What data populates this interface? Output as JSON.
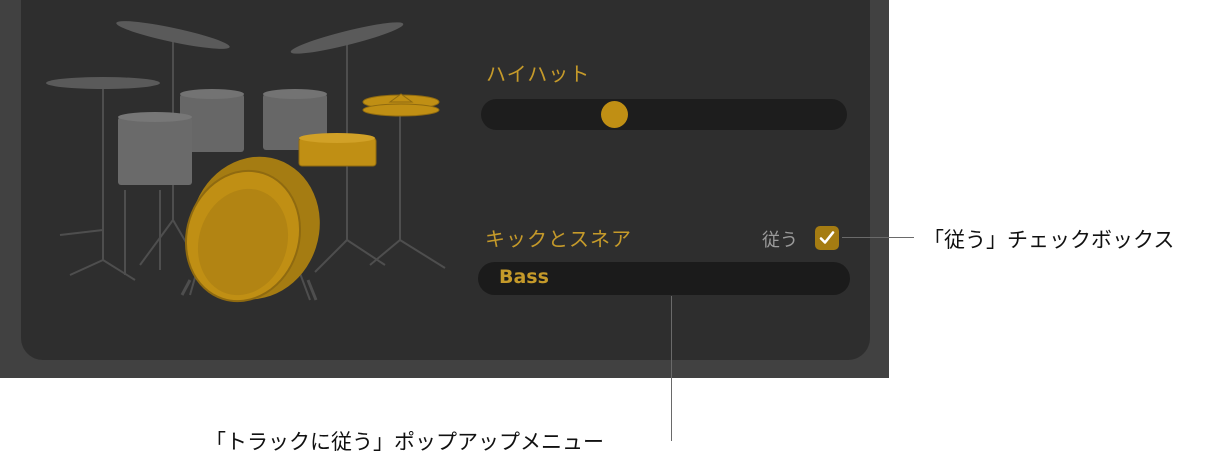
{
  "hihat": {
    "label": "ハイハット",
    "slider_fraction": 0.35
  },
  "kick_snare": {
    "label": "キックとスネア",
    "follow_label": "従う",
    "follow_checked": true,
    "popup_value": "Bass"
  },
  "callouts": {
    "follow_checkbox": "「従う」チェックボックス",
    "follow_track_popup": "「トラックに従う」ポップアップメニュー"
  },
  "colors": {
    "accent": "#c59a2a",
    "drum_highlight": "#c08f14",
    "drum_gray": "#666666",
    "panel_bg": "#2e2e2e"
  }
}
